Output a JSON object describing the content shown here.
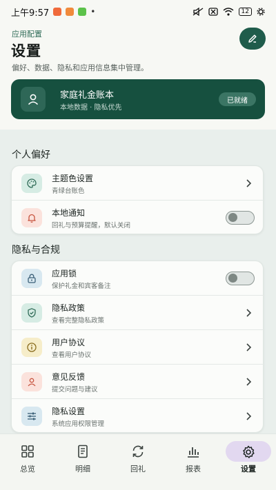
{
  "status_bar": {
    "time": "上午9:57",
    "battery": "12",
    "notification_colors": [
      "#f06a3b",
      "#f08a3b",
      "#5cc24a"
    ]
  },
  "header": {
    "app_config": "应用配置",
    "title": "设置",
    "description": "偏好、数据、隐私和应用信息集中管理。"
  },
  "account": {
    "name": "家庭礼金账本",
    "subtitle": "本地数据 · 隐私优先",
    "badge": "已就绪"
  },
  "sections": {
    "personal": {
      "title": "个人偏好",
      "items": [
        {
          "title": "主题色设置",
          "subtitle": "青绿台账色",
          "icon": "palette-icon",
          "control": "chevron"
        },
        {
          "title": "本地通知",
          "subtitle": "回礼与预算提醒，默认关闭",
          "icon": "bell-icon",
          "control": "toggle",
          "on": false
        }
      ]
    },
    "privacy": {
      "title": "隐私与合规",
      "items": [
        {
          "title": "应用锁",
          "subtitle": "保护礼金和宾客备注",
          "icon": "lock-icon",
          "control": "toggle",
          "on": false
        },
        {
          "title": "隐私政策",
          "subtitle": "查看完整隐私政策",
          "icon": "shield-icon",
          "control": "chevron"
        },
        {
          "title": "用户协议",
          "subtitle": "查看用户协议",
          "icon": "info-icon",
          "control": "chevron"
        },
        {
          "title": "意见反馈",
          "subtitle": "提交问题与建议",
          "icon": "person-icon",
          "control": "chevron"
        },
        {
          "title": "隐私设置",
          "subtitle": "系统应用权限管理",
          "icon": "sliders-icon",
          "control": "chevron"
        }
      ]
    }
  },
  "bottom_nav": [
    {
      "label": "总览",
      "icon": "grid-icon",
      "active": false
    },
    {
      "label": "明细",
      "icon": "document-icon",
      "active": false
    },
    {
      "label": "回礼",
      "icon": "refresh-icon",
      "active": false
    },
    {
      "label": "报表",
      "icon": "bar-chart-icon",
      "active": false
    },
    {
      "label": "设置",
      "icon": "gear-icon",
      "active": true
    }
  ],
  "colors": {
    "primary": "#16503f",
    "accent_nav": "#e2d8f0",
    "background": "#e9efec"
  }
}
